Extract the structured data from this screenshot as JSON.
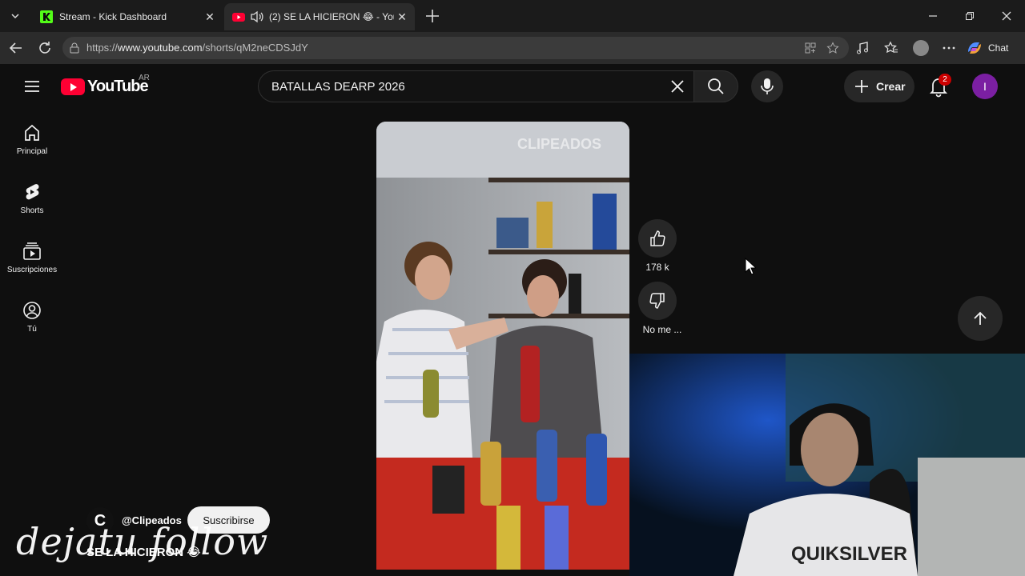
{
  "browser": {
    "tabs": [
      {
        "title": "Stream - Kick Dashboard",
        "favicon": "kick-icon",
        "active": false
      },
      {
        "title": "(2) SE LA HICIERON 😂 - YouTube",
        "favicon": "youtube-icon",
        "active": true,
        "muted_icon": "speaker-icon"
      }
    ],
    "url_prefix": "https://",
    "url_host": "www.youtube.com",
    "url_path": "/shorts/qM2neCDSJdY",
    "chat_label": "Chat"
  },
  "youtube": {
    "logo_text": "YouTube",
    "country": "AR",
    "search_query": "BATALLAS DEARP 2026",
    "create_label": "Crear",
    "notification_count": "2",
    "avatar_initial": "I",
    "sidebar": [
      {
        "label": "Principal",
        "icon": "home-icon"
      },
      {
        "label": "Shorts",
        "icon": "shorts-icon"
      },
      {
        "label": "Suscripciones",
        "icon": "subscriptions-icon"
      },
      {
        "label": "Tú",
        "icon": "you-icon"
      }
    ]
  },
  "short": {
    "watermark": "CLIPEADOS",
    "likes": "178 k",
    "dislike_label": "No me ...",
    "channel_initial": "C",
    "channel": "@Clipeados",
    "subscribe_label": "Suscribirse",
    "title": "SE LA HICIERON 😂"
  },
  "overlay": {
    "follow_text": "dejatu follow",
    "webcam_shirt_text": "QUIKSILVER"
  },
  "colors": {
    "yt_red": "#ff0033",
    "kick_green": "#53fc18",
    "avatar_purple": "#7b1fa2",
    "badge_red": "#cc0000"
  }
}
